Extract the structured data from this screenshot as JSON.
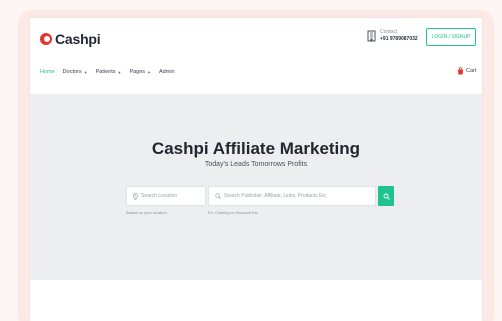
{
  "brand": {
    "name": "Cashpi",
    "color": "#e5342c"
  },
  "header": {
    "contact_label": "Contact",
    "contact_phone": "+91 9789087032",
    "login_label": "LOGIN / SIGNUP",
    "accent": "#1ec48c"
  },
  "nav": {
    "items": [
      {
        "label": "Home",
        "dropdown": false,
        "active": true
      },
      {
        "label": "Doctors",
        "dropdown": true,
        "active": false
      },
      {
        "label": "Patients",
        "dropdown": true,
        "active": false
      },
      {
        "label": "Pages",
        "dropdown": true,
        "active": false
      },
      {
        "label": "Admin",
        "dropdown": false,
        "active": false
      }
    ],
    "cart_label": "Cart"
  },
  "hero": {
    "title": "Cashpi Affiliate Marketing",
    "subtitle": "Today's Leads Tomorrows Profits",
    "location_placeholder": "Search Location",
    "location_hint": "Based on your location",
    "search_placeholder": "Search Publisher, Affiliate, Links, Products Etc",
    "search_hint": "Ex: Clothing or Discount Etc"
  },
  "icons": {
    "contact": "building-icon",
    "cart": "shopping-bag-icon",
    "location": "map-pin-icon",
    "search": "search-icon",
    "search_button": "search-icon"
  }
}
